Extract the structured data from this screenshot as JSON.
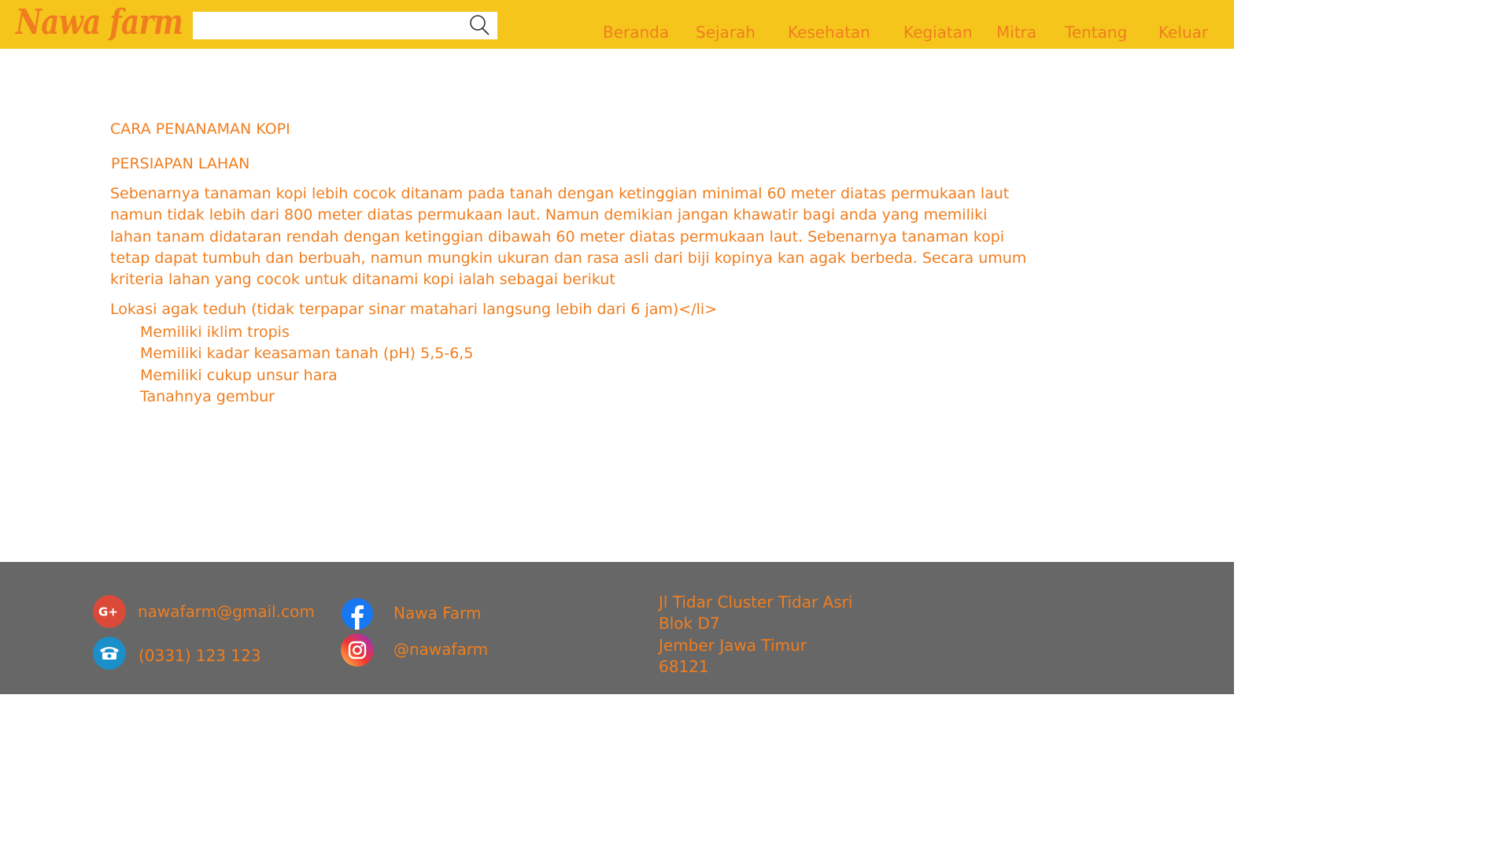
{
  "header": {
    "logo": "Nawa farm",
    "search": {
      "value": "",
      "placeholder": ""
    },
    "nav": [
      "Beranda",
      "Sejarah",
      "Kesehatan",
      "Kegiatan",
      "Mitra",
      "Tentang",
      "Keluar"
    ]
  },
  "main": {
    "title": "CARA PENANAMAN KOPI",
    "section_title": "PERSIAPAN LAHAN",
    "paragraph": " Sebenarnya tanaman kopi lebih cocok ditanam pada tanah dengan ketinggian minimal 60 meter  diatas permukaan laut namun tidak lebih dari 800 meter diatas permukaan laut. Namun demikian jangan khawatir bagi anda yang memiliki lahan tanam didataran rendah dengan ketinggian dibawah 60 meter diatas permukaan laut. Sebenarnya tanaman kopi tetap dapat tumbuh dan berbuah, namun mungkin ukuran dan rasa asli dari biji kopinya kan agak berbeda. Secara umum kriteria lahan yang cocok untuk ditanami kopi ialah sebagai berikut",
    "criteria_lead": "Lokasi agak teduh (tidak terpapar sinar matahari langsung lebih dari 6 jam)</li>",
    "criteria": [
      "Memiliki iklim tropis",
      "Memiliki kadar keasaman tanah (pH) 5,5-6,5",
      "Memiliki cukup unsur hara",
      "Tanahnya gembur"
    ]
  },
  "footer": {
    "email": "nawafarm@gmail.com",
    "phone": "(0331) 123 123",
    "facebook": "Nawa Farm",
    "instagram": "@nawafarm",
    "address": [
      "Jl Tidar Cluster Tidar Asri",
      "Blok D7",
      "Jember Jawa Timur",
      "68121"
    ]
  },
  "colors": {
    "header_bg": "#f5c51c",
    "accent": "#f07e1f",
    "footer_bg": "#676767",
    "google_icon": "#db4a39",
    "phone_icon": "#1a8fc9",
    "facebook_icon": "#1877f2"
  },
  "icons": [
    "search-icon",
    "google-plus-icon",
    "phone-icon",
    "facebook-icon",
    "instagram-icon"
  ]
}
